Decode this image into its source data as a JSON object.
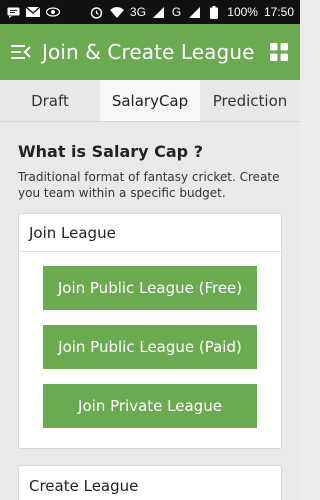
{
  "status_bar": {
    "left_icons": [
      "sms-icon",
      "gmail-icon",
      "eye-icon"
    ],
    "right_icons": [
      "alarm-icon",
      "wifi-icon",
      "signal-icon",
      "signal-icon",
      "battery-icon"
    ],
    "network1": "3G",
    "network2": "G",
    "battery": "100%",
    "time": "17:50"
  },
  "app_bar": {
    "title": "Join & Create League",
    "color": "#6aaa51"
  },
  "tabs": [
    {
      "label": "Draft",
      "active": false
    },
    {
      "label": "SalaryCap",
      "active": true
    },
    {
      "label": "Prediction",
      "active": false
    }
  ],
  "content": {
    "title": "What is Salary Cap ?",
    "description": "Traditional format of fantasy cricket. Create you team within a specific budget.",
    "join_card": {
      "header": "Join League",
      "buttons": [
        "Join Public League (Free)",
        "Join Public League (Paid)",
        "Join Private League"
      ]
    },
    "create_card": {
      "header": "Create League"
    }
  }
}
